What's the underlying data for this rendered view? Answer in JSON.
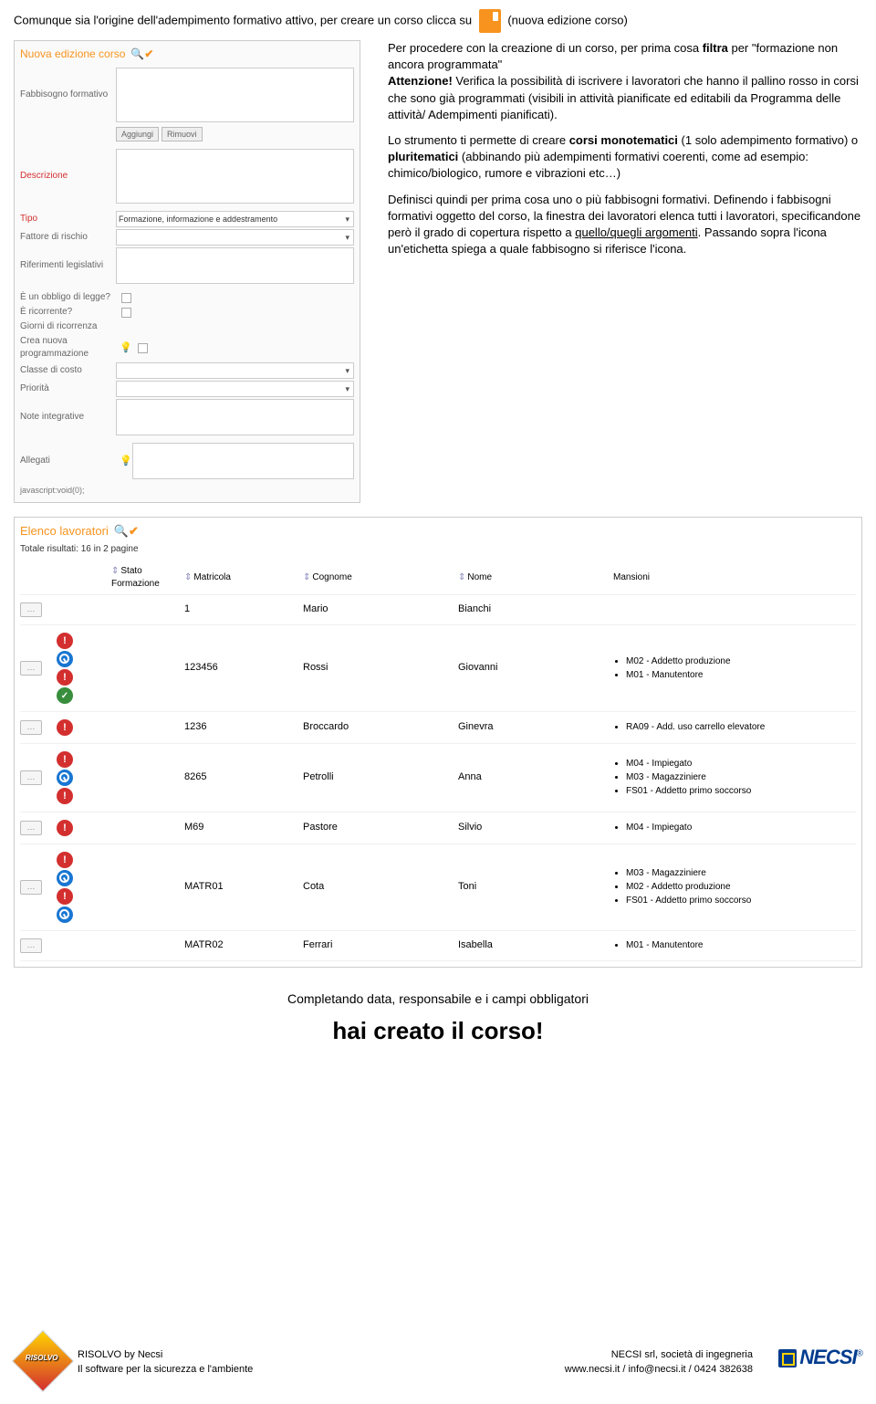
{
  "intro": {
    "before": "Comunque sia l'origine dell'adempimento formativo attivo, per creare un corso clicca su",
    "after": "(nuova edizione corso)"
  },
  "formShot": {
    "title": "Nuova edizione corso",
    "lbl_fabbisogno": "Fabbisogno formativo",
    "btn_aggiungi": "Aggiungi",
    "btn_rimuovi": "Rimuovi",
    "lbl_descrizione": "Descrizione",
    "lbl_tipo": "Tipo",
    "val_tipo": "Formazione, informazione e addestramento",
    "lbl_fattore": "Fattore di rischio",
    "lbl_riferimenti": "Riferimenti legislativi",
    "lbl_obbligo": "È un obbligo di legge?",
    "lbl_ricorrente": "È ricorrente?",
    "lbl_giorni": "Giorni di ricorrenza",
    "lbl_crea": "Crea nuova programmazione",
    "lbl_classe": "Classe di costo",
    "lbl_priorita": "Priorità",
    "lbl_note": "Note integrative",
    "lbl_allegati": "Allegati",
    "status": "javascript:void(0);"
  },
  "rightText": {
    "p1pre": "Per procedere con la creazione di un corso, per prima cosa ",
    "p1b1": "filtra",
    "p1mid": " per \"formazione non ancora programmata\"",
    "p1b2": "Attenzione!",
    "p1post": " Verifica la possibilità di iscrivere i lavoratori che hanno il pallino rosso in corsi che sono già programmati (visibili in attività pianificate ed editabili da Programma delle attività/ Adempimenti pianificati).",
    "p2pre": "Lo strumento ti permette di creare ",
    "p2b1": "corsi monotematici",
    "p2mid": " (1 solo adempimento formativo) o ",
    "p2b2": "pluritematici",
    "p2post": " (abbinando più adempimenti formativi coerenti, come ad esempio: chimico/biologico, rumore e vibrazioni etc…)",
    "p3pre": "Definisci quindi per prima cosa uno o più fabbisogni formativi. Definendo i fabbisogni formativi oggetto del corso, la finestra dei lavoratori elenca tutti i lavoratori, specificandone però il grado di copertura rispetto a ",
    "p3u": "quello/quegli argomenti",
    "p3post": ". Passando sopra l'icona un'etichetta spiega a quale fabbisogno si riferisce l'icona."
  },
  "tableShot": {
    "title": "Elenco lavoratori",
    "sub": "Totale risultati: 16 in 2 pagine",
    "h_stato": "Stato\nFormazione",
    "h_mat": "Matricola",
    "h_cog": "Cognome",
    "h_nome": "Nome",
    "h_man": "Mansioni",
    "rows": [
      {
        "icons": [],
        "mat": "1",
        "cog": "Mario",
        "nome": "Bianchi",
        "man": []
      },
      {
        "icons": [
          "red",
          "blue",
          "red",
          "green"
        ],
        "mat": "123456",
        "cog": "Rossi",
        "nome": "Giovanni",
        "man": [
          "M02 - Addetto produzione",
          "M01 - Manutentore"
        ]
      },
      {
        "icons": [
          "red"
        ],
        "mat": "1236",
        "cog": "Broccardo",
        "nome": "Ginevra",
        "man": [
          "RA09 - Add. uso carrello elevatore"
        ]
      },
      {
        "icons": [
          "red",
          "blue",
          "red"
        ],
        "mat": "8265",
        "cog": "Petrolli",
        "nome": "Anna",
        "man": [
          "M04 - Impiegato",
          "M03 - Magazziniere",
          "FS01 - Addetto primo soccorso"
        ]
      },
      {
        "icons": [
          "red"
        ],
        "mat": "M69",
        "cog": "Pastore",
        "nome": "Silvio",
        "man": [
          "M04 - Impiegato"
        ]
      },
      {
        "icons": [
          "red",
          "blue",
          "red",
          "blue"
        ],
        "mat": "MATR01",
        "cog": "Cota",
        "nome": "Toni",
        "man": [
          "M03 - Magazziniere",
          "M02 - Addetto produzione",
          "FS01 - Addetto primo soccorso"
        ]
      },
      {
        "icons": [],
        "mat": "MATR02",
        "cog": "Ferrari",
        "nome": "Isabella",
        "man": [
          "M01 - Manutentore"
        ]
      }
    ]
  },
  "bottom": {
    "line1": "Completando data, responsabile e i campi obbligatori",
    "line2": "hai creato il corso!"
  },
  "footer": {
    "risolvo": "RISOLVO",
    "left1": "RISOLVO by Necsi",
    "left2": "Il software per la sicurezza e l'ambiente",
    "right1": "NECSI srl, società di ingegneria",
    "right2": "www.necsi.it / info@necsi.it / 0424 382638",
    "necsi": "NECSI"
  }
}
